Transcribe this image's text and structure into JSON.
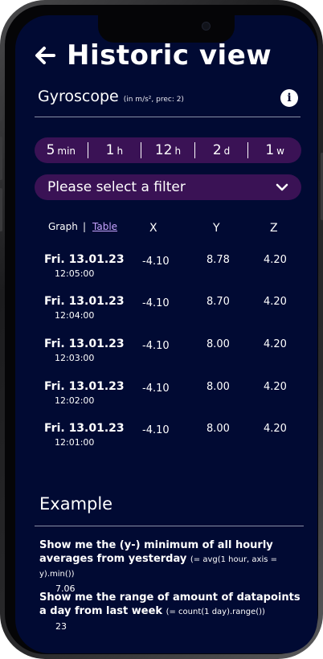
{
  "header": {
    "title": "Historic view"
  },
  "sensor": {
    "name": "Gyroscope",
    "meta": "(in m/s², prec: 2)"
  },
  "time_ranges": [
    {
      "num": "5",
      "unit": "min"
    },
    {
      "num": "1",
      "unit": "h"
    },
    {
      "num": "12",
      "unit": "h"
    },
    {
      "num": "2",
      "unit": "d"
    },
    {
      "num": "1",
      "unit": "w"
    }
  ],
  "filter": {
    "placeholder": "Please select a filter"
  },
  "table": {
    "view_graph": "Graph",
    "view_separator": "|",
    "view_table": "Table",
    "col_x": "X",
    "col_y": "Y",
    "col_z": "Z",
    "rows": [
      {
        "date": "Fri. 13.01.23",
        "time": "12:05:00",
        "x": "-4.10",
        "y": "8.78",
        "z": "4.20"
      },
      {
        "date": "Fri. 13.01.23",
        "time": "12:04:00",
        "x": "-4.10",
        "y": "8.70",
        "z": "4.20"
      },
      {
        "date": "Fri. 13.01.23",
        "time": "12:03:00",
        "x": "-4.10",
        "y": "8.00",
        "z": "4.20"
      },
      {
        "date": "Fri. 13.01.23",
        "time": "12:02:00",
        "x": "-4.10",
        "y": "8.00",
        "z": "4.20"
      },
      {
        "date": "Fri. 13.01.23",
        "time": "12:01:00",
        "x": "-4.10",
        "y": "8.00",
        "z": "4.20"
      }
    ]
  },
  "example": {
    "title": "Example",
    "items": [
      {
        "question": "Show me the (y-) minimum of all hourly averages from yesterday",
        "code": "(= avg(1 hour, axis = y).min())",
        "answer": "7.06"
      },
      {
        "question": "Show me the range of amount of datapoints a day from last week",
        "code": "(= count(1 day).range())",
        "answer": "23"
      }
    ]
  },
  "colors": {
    "background": "#010a33",
    "pill": "#3a1255",
    "link": "#c8a4ff"
  }
}
